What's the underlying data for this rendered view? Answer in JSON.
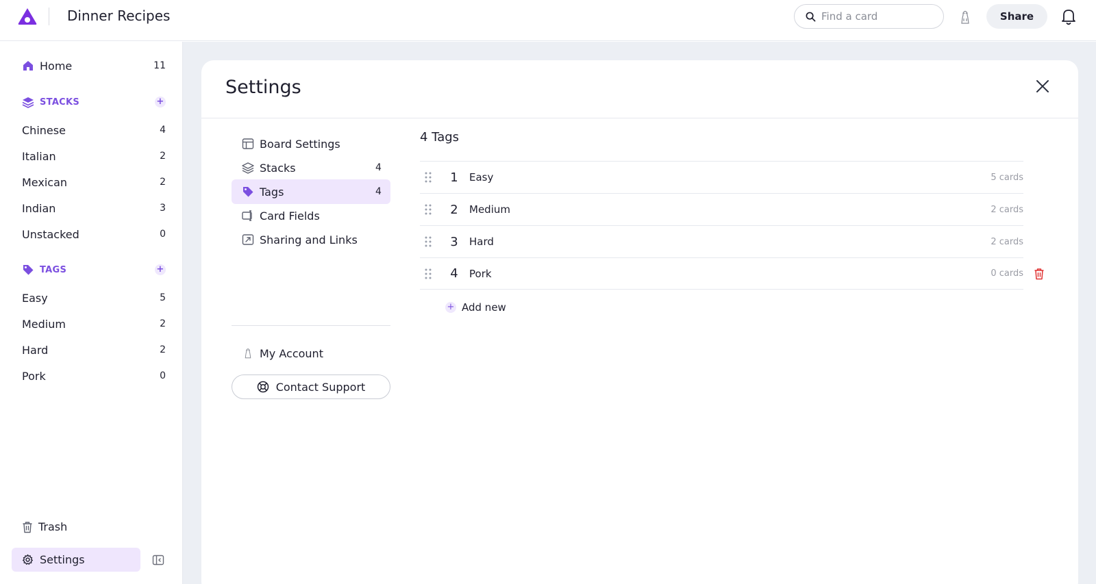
{
  "header": {
    "title": "Dinner Recipes",
    "search_placeholder": "Find a card",
    "share_label": "Share"
  },
  "sidebar": {
    "home": {
      "label": "Home",
      "count": "11"
    },
    "stacks_heading": "STACKS",
    "stacks": [
      {
        "label": "Chinese",
        "count": "4"
      },
      {
        "label": "Italian",
        "count": "2"
      },
      {
        "label": "Mexican",
        "count": "2"
      },
      {
        "label": "Indian",
        "count": "3"
      },
      {
        "label": "Unstacked",
        "count": "0"
      }
    ],
    "tags_heading": "TAGS",
    "tags": [
      {
        "label": "Easy",
        "count": "5"
      },
      {
        "label": "Medium",
        "count": "2"
      },
      {
        "label": "Hard",
        "count": "2"
      },
      {
        "label": "Pork",
        "count": "0"
      }
    ],
    "trash_label": "Trash",
    "settings_label": "Settings"
  },
  "settings": {
    "title": "Settings",
    "nav": [
      {
        "label": "Board Settings",
        "count": ""
      },
      {
        "label": "Stacks",
        "count": "4"
      },
      {
        "label": "Tags",
        "count": "4"
      },
      {
        "label": "Card Fields",
        "count": ""
      },
      {
        "label": "Sharing and Links",
        "count": ""
      }
    ],
    "my_account_label": "My Account",
    "contact_support_label": "Contact Support",
    "tags_heading": "4 Tags",
    "tag_rows": [
      {
        "num": "1",
        "name": "Easy",
        "cards": "5 cards"
      },
      {
        "num": "2",
        "name": "Medium",
        "cards": "2 cards"
      },
      {
        "num": "3",
        "name": "Hard",
        "cards": "2 cards"
      },
      {
        "num": "4",
        "name": "Pork",
        "cards": "0 cards"
      }
    ],
    "add_new_label": "Add new"
  },
  "colors": {
    "accent": "#7b4fe0",
    "active_bg": "#efe6fd",
    "main_bg": "#eceff4",
    "danger": "#e03131"
  },
  "icons": {
    "logo": "app-logo-icon",
    "search": "search-icon",
    "avatar": "avatar-icon",
    "bell": "bell-icon",
    "home": "home-icon",
    "stacks": "stacks-icon",
    "tags": "tag-icon",
    "trash": "trash-icon",
    "settings": "gear-icon",
    "collapse": "sidebar-collapse-icon",
    "close": "close-icon",
    "drag": "drag-handle-icon",
    "support": "lifebuoy-icon"
  }
}
